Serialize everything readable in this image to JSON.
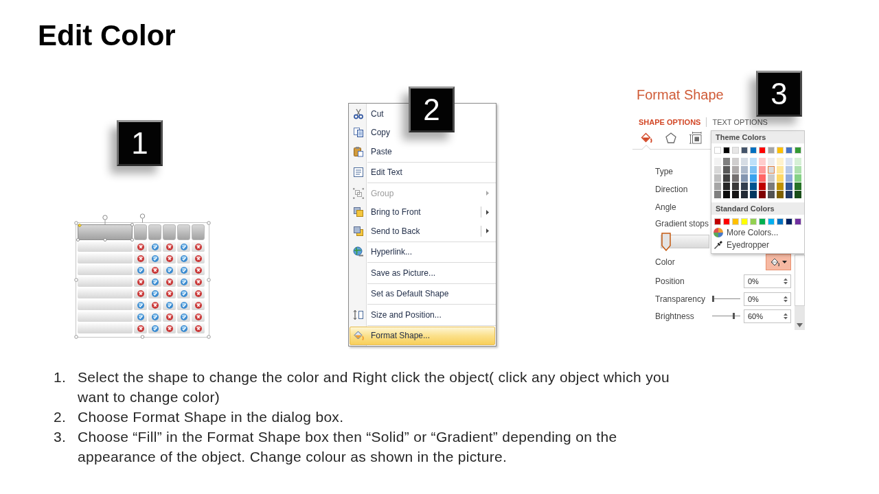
{
  "title": {
    "text": "Edit Color"
  },
  "panels": [
    {
      "badge": "1",
      "table": {
        "selected": true,
        "rows": [
          {
            "cells": [
              {
                "checked": false
              },
              {
                "checked": true
              },
              {
                "checked": false
              },
              {
                "checked": true
              },
              {
                "checked": false
              }
            ]
          },
          {
            "cells": [
              {
                "checked": false
              },
              {
                "checked": true
              },
              {
                "checked": false
              },
              {
                "checked": true
              },
              {
                "checked": false
              }
            ]
          },
          {
            "cells": [
              {
                "checked": true
              },
              {
                "checked": false
              },
              {
                "checked": true
              },
              {
                "checked": true
              },
              {
                "checked": false
              }
            ]
          },
          {
            "cells": [
              {
                "checked": false
              },
              {
                "checked": true
              },
              {
                "checked": false
              },
              {
                "checked": true
              },
              {
                "checked": false
              }
            ]
          },
          {
            "cells": [
              {
                "checked": false
              },
              {
                "checked": true
              },
              {
                "checked": false
              },
              {
                "checked": true
              },
              {
                "checked": false
              }
            ]
          },
          {
            "cells": [
              {
                "checked": true
              },
              {
                "checked": false
              },
              {
                "checked": true
              },
              {
                "checked": true
              },
              {
                "checked": false
              }
            ]
          },
          {
            "cells": [
              {
                "checked": true
              },
              {
                "checked": true
              },
              {
                "checked": false
              },
              {
                "checked": true
              },
              {
                "checked": false
              }
            ]
          },
          {
            "cells": [
              {
                "checked": false
              },
              {
                "checked": true
              },
              {
                "checked": false
              },
              {
                "checked": true
              },
              {
                "checked": false
              }
            ]
          }
        ]
      }
    },
    {
      "badge": "2",
      "context_menu": {
        "groups": [
          {
            "items": [
              {
                "label": "Cut",
                "kind": "plain",
                "disabled": false,
                "selected": false
              },
              {
                "label": "Copy",
                "kind": "plain",
                "disabled": false,
                "selected": false
              },
              {
                "label": "Paste",
                "kind": "plain",
                "disabled": false,
                "selected": false
              }
            ]
          },
          {
            "items": [
              {
                "label": "Edit Text",
                "kind": "plain",
                "disabled": false,
                "selected": false
              }
            ]
          },
          {
            "items": [
              {
                "label": "Group",
                "kind": "submenu",
                "disabled": true,
                "selected": false
              },
              {
                "label": "Bring to Front",
                "kind": "split",
                "disabled": false,
                "selected": false
              },
              {
                "label": "Send to Back",
                "kind": "split",
                "disabled": false,
                "selected": false
              }
            ]
          },
          {
            "items": [
              {
                "label": "Hyperlink...",
                "kind": "plain",
                "disabled": false,
                "selected": false
              }
            ]
          },
          {
            "items": [
              {
                "label": "Save as Picture...",
                "kind": "plain",
                "disabled": false,
                "selected": false
              }
            ]
          },
          {
            "items": [
              {
                "label": "Set as Default Shape",
                "kind": "plain",
                "disabled": false,
                "selected": false
              }
            ]
          },
          {
            "items": [
              {
                "label": "Size and Position...",
                "kind": "plain",
                "disabled": false,
                "selected": false
              }
            ]
          },
          {
            "items": [
              {
                "label": "Format Shape...",
                "kind": "plain",
                "disabled": false,
                "selected": true
              }
            ]
          }
        ]
      }
    },
    {
      "badge": "3",
      "format_pane": {
        "title": "Format Shape",
        "tabs": [
          {
            "label": "SHAPE OPTIONS",
            "selected": true
          },
          {
            "label": "TEXT OPTIONS",
            "selected": false
          }
        ],
        "icon_tabs": [
          {
            "selected": true
          },
          {
            "selected": false
          },
          {
            "selected": false
          }
        ],
        "fields": [
          {
            "kind": "label",
            "label": "Type"
          },
          {
            "kind": "label",
            "label": "Direction"
          },
          {
            "kind": "label",
            "label": "Angle"
          },
          {
            "kind": "gradient",
            "label": "Gradient stops",
            "level": 0
          },
          {
            "kind": "color",
            "label": "Color"
          },
          {
            "kind": "spin",
            "label": "Position",
            "value": "0%"
          },
          {
            "kind": "slider",
            "label": "Transparency",
            "level": 0,
            "value": "0%"
          },
          {
            "kind": "slider",
            "label": "Brightness",
            "level": 0.8,
            "value": "60%"
          }
        ],
        "color_dropdown": {
          "theme_header": "Theme Colors",
          "theme_colors": [
            {
              "color": "#ffffff",
              "selected": false,
              "shades": [
                {
                  "color": "#f2f2f2",
                  "selected": false
                },
                {
                  "color": "#d9d9d9",
                  "selected": false
                },
                {
                  "color": "#bfbfbf",
                  "selected": false
                },
                {
                  "color": "#a6a6a6",
                  "selected": false
                },
                {
                  "color": "#808080",
                  "selected": false
                }
              ]
            },
            {
              "color": "#000000",
              "selected": false,
              "shades": [
                {
                  "color": "#7f7f7f",
                  "selected": false
                },
                {
                  "color": "#595959",
                  "selected": false
                },
                {
                  "color": "#3f3f3f",
                  "selected": false
                },
                {
                  "color": "#262626",
                  "selected": false
                },
                {
                  "color": "#0d0d0d",
                  "selected": false
                }
              ]
            },
            {
              "color": "#e7e6e6",
              "selected": false,
              "shades": [
                {
                  "color": "#d0cece",
                  "selected": false
                },
                {
                  "color": "#aeaaaa",
                  "selected": false
                },
                {
                  "color": "#757070",
                  "selected": false
                },
                {
                  "color": "#3a3838",
                  "selected": false
                },
                {
                  "color": "#171616",
                  "selected": false
                }
              ]
            },
            {
              "color": "#44546a",
              "selected": false,
              "shades": [
                {
                  "color": "#d6dce4",
                  "selected": false
                },
                {
                  "color": "#adb9ca",
                  "selected": false
                },
                {
                  "color": "#8496b0",
                  "selected": false
                },
                {
                  "color": "#333f4f",
                  "selected": false
                },
                {
                  "color": "#222a35",
                  "selected": false
                }
              ]
            },
            {
              "color": "#0070c0",
              "selected": false,
              "shades": [
                {
                  "color": "#bde0f9",
                  "selected": false
                },
                {
                  "color": "#7cc1f3",
                  "selected": false
                },
                {
                  "color": "#3aa2ed",
                  "selected": false
                },
                {
                  "color": "#00538f",
                  "selected": false
                },
                {
                  "color": "#00375f",
                  "selected": false
                }
              ]
            },
            {
              "color": "#ff0000",
              "selected": false,
              "shades": [
                {
                  "color": "#ffcccc",
                  "selected": false
                },
                {
                  "color": "#ff9999",
                  "selected": false
                },
                {
                  "color": "#ff6666",
                  "selected": false
                },
                {
                  "color": "#bf0000",
                  "selected": false
                },
                {
                  "color": "#7f0000",
                  "selected": false
                }
              ]
            },
            {
              "color": "#a5a5a5",
              "selected": false,
              "shades": [
                {
                  "color": "#ededed",
                  "selected": false
                },
                {
                  "color": "#dbdbdb",
                  "selected": true
                },
                {
                  "color": "#c9c9c9",
                  "selected": false
                },
                {
                  "color": "#7b7b7b",
                  "selected": false
                },
                {
                  "color": "#525252",
                  "selected": false
                }
              ]
            },
            {
              "color": "#ffc000",
              "selected": false,
              "shades": [
                {
                  "color": "#fff2cc",
                  "selected": false
                },
                {
                  "color": "#ffe699",
                  "selected": false
                },
                {
                  "color": "#ffd966",
                  "selected": false
                },
                {
                  "color": "#bf9000",
                  "selected": false
                },
                {
                  "color": "#7f6000",
                  "selected": false
                }
              ]
            },
            {
              "color": "#4472c4",
              "selected": false,
              "shades": [
                {
                  "color": "#dae3f3",
                  "selected": false
                },
                {
                  "color": "#b4c7e7",
                  "selected": false
                },
                {
                  "color": "#8faadc",
                  "selected": false
                },
                {
                  "color": "#2f5597",
                  "selected": false
                },
                {
                  "color": "#1f3864",
                  "selected": false
                }
              ]
            },
            {
              "color": "#339933",
              "selected": false,
              "shades": [
                {
                  "color": "#d6f0d6",
                  "selected": false
                },
                {
                  "color": "#ade0ad",
                  "selected": false
                },
                {
                  "color": "#85d185",
                  "selected": false
                },
                {
                  "color": "#267326",
                  "selected": false
                },
                {
                  "color": "#194d19",
                  "selected": false
                }
              ]
            }
          ],
          "standard_header": "Standard Colors",
          "standard_colors": [
            {
              "color": "#c00000",
              "selected": false
            },
            {
              "color": "#ff0000",
              "selected": false
            },
            {
              "color": "#ffc000",
              "selected": false
            },
            {
              "color": "#ffff00",
              "selected": false
            },
            {
              "color": "#92d050",
              "selected": false
            },
            {
              "color": "#00b050",
              "selected": false
            },
            {
              "color": "#00b0f0",
              "selected": false
            },
            {
              "color": "#0070c0",
              "selected": false
            },
            {
              "color": "#002060",
              "selected": false
            },
            {
              "color": "#7030a0",
              "selected": false
            }
          ],
          "actions": [
            {
              "label": "More Colors..."
            },
            {
              "label": "Eyedropper"
            }
          ]
        }
      }
    }
  ],
  "instructions": [
    {
      "number": "1.",
      "text": "Select the shape to change the color and Right click the object( click any object which you want to change color)"
    },
    {
      "number": "2.",
      "text": "Choose Format Shape in the dialog box."
    },
    {
      "number": "3.",
      "text": "Choose “Fill” in the Format Shape box then “Solid” or “Gradient” depending on the appearance of the object. Change colour as shown in the picture."
    }
  ]
}
